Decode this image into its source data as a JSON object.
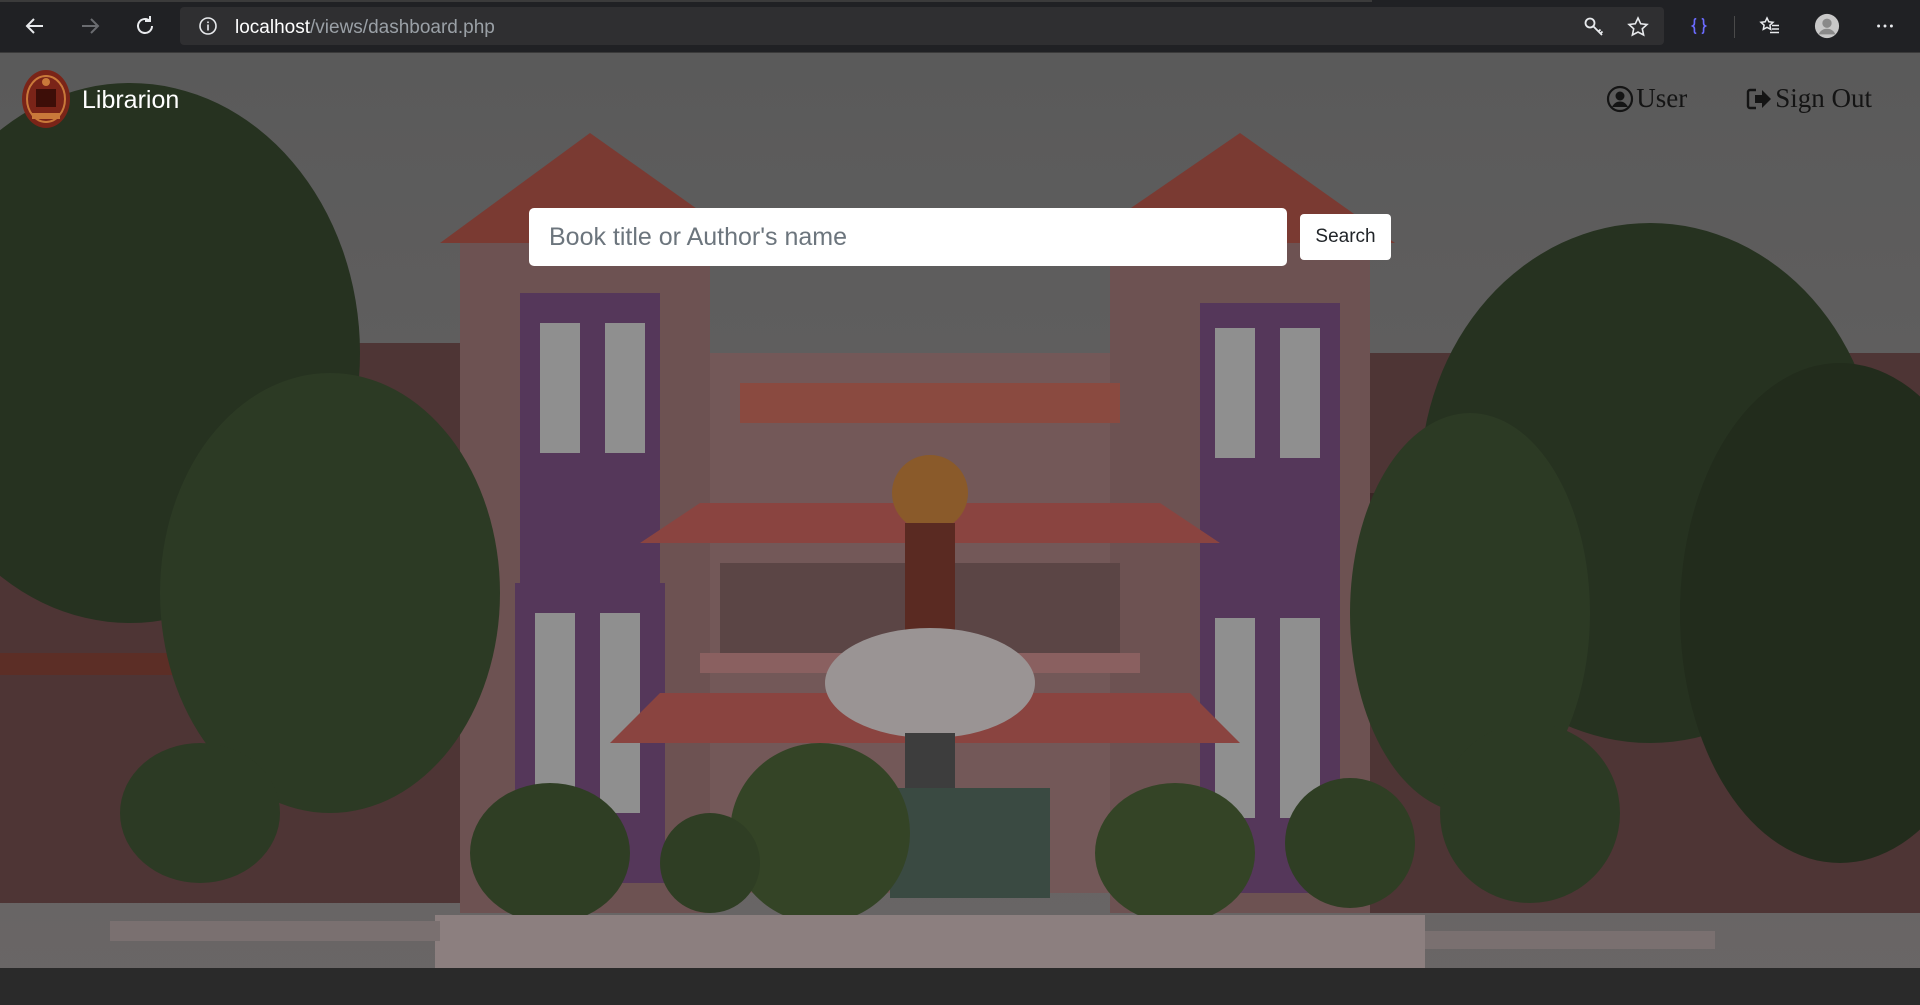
{
  "browser": {
    "url_host": "localhost",
    "url_path": "/views/dashboard.php",
    "icons": {
      "back": "arrow-left-icon",
      "forward": "arrow-right-icon",
      "reload": "reload-icon",
      "info": "info-icon",
      "passwords": "key-icon",
      "favorite": "star-icon",
      "extension": "braces-extension-icon",
      "collections": "favorites-list-icon",
      "profile": "profile-avatar-icon",
      "menu": "more-icon"
    }
  },
  "navbar": {
    "brand_name": "Librarion",
    "user_label": "User",
    "signout_label": "Sign Out"
  },
  "search": {
    "placeholder": "Book title or Author's name",
    "button_label": "Search"
  },
  "colors": {
    "chrome_bg": "#202124",
    "brand_text": "#ffffff",
    "nav_text": "#141414",
    "search_bg": "#ffffff"
  }
}
